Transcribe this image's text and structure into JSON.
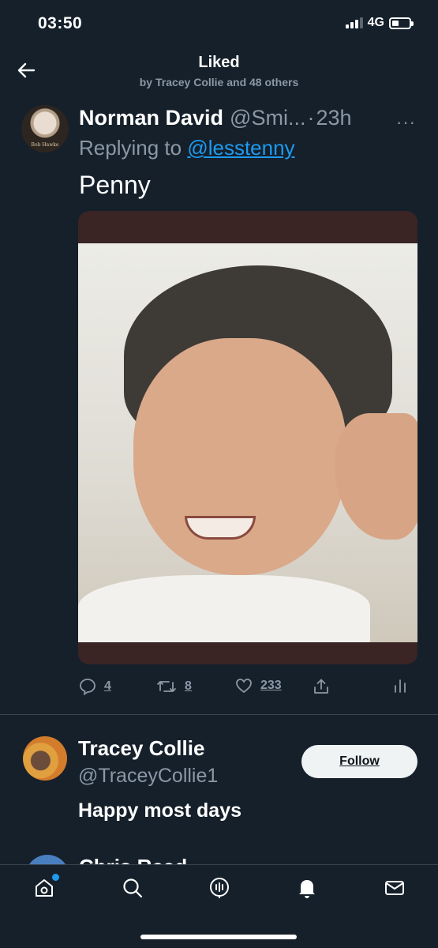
{
  "status_bar": {
    "time": "03:50",
    "network": "4G",
    "battery_level": 0.4
  },
  "header": {
    "title": "Liked",
    "subtitle": "by Tracey Collie and 48 others"
  },
  "tweet": {
    "author_name": "Norman David",
    "author_handle": "@Smi...",
    "separator": "·",
    "time": "23h",
    "more": "···",
    "reply_prefix": "Replying to ",
    "reply_to": "@lesstenny",
    "text": "Penny",
    "avatar_caption": "Bob Hawke",
    "stats": {
      "replies": "4",
      "retweets": "8",
      "likes": "233"
    }
  },
  "liked_by": {
    "name": "Tracey Collie",
    "handle": "@TraceyCollie1",
    "bio": "Happy most days",
    "follow_label": "Follow"
  },
  "next_user": {
    "name_partial": "Chris Read"
  },
  "tabbar": {
    "items": [
      "home",
      "search",
      "spaces",
      "notifications",
      "messages"
    ]
  },
  "colors": {
    "background": "#15202b",
    "accent": "#1d9bf0",
    "secondary_text": "#8b98a5"
  }
}
